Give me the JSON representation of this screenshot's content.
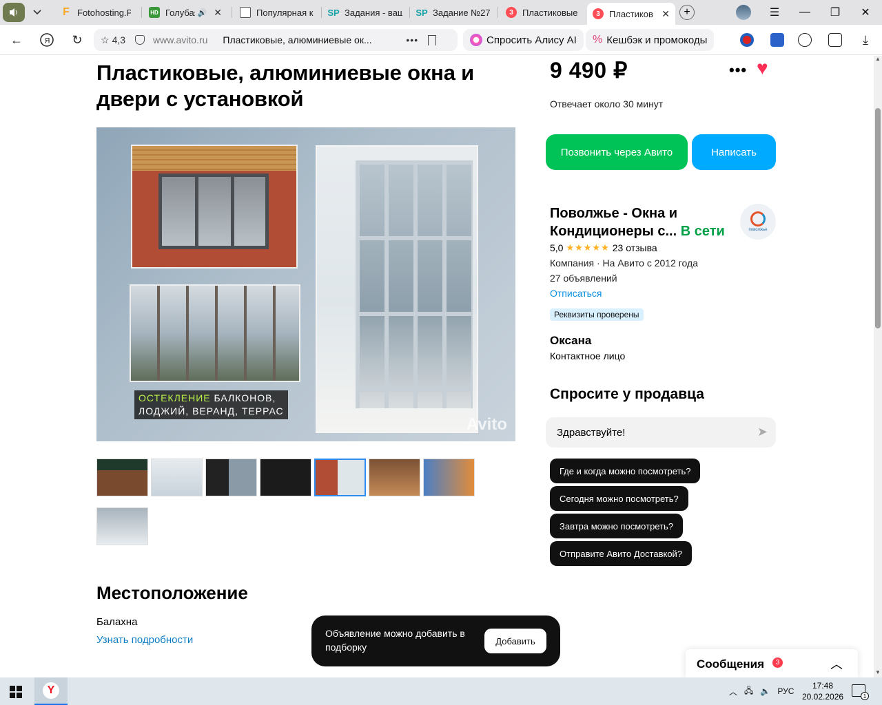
{
  "browser": {
    "tabs": [
      {
        "label": "Fotohosting.P",
        "favicon": "F",
        "favicon_color": "#f5a623"
      },
      {
        "label": "Голубая",
        "favicon": "HD",
        "favicon_color": "#3a9a3a"
      },
      {
        "label": "Популярная к",
        "favicon": "",
        "favicon_color": "#888888"
      },
      {
        "label": "Задания - ваш",
        "favicon": "SP",
        "favicon_color": "#1aa3a8"
      },
      {
        "label": "Задание №27",
        "favicon": "SP",
        "favicon_color": "#1aa3a8"
      },
      {
        "label": "Пластиковые",
        "favicon": "3",
        "favicon_color": "#ff4d55"
      },
      {
        "label": "Пластиков",
        "favicon": "3",
        "favicon_color": "#ff4d55"
      }
    ],
    "rating": "4,3",
    "domain": "www.avito.ru",
    "page_title": "Пластиковые, алюминиевые ок...",
    "alice_label": "Спросить Алису AI",
    "cashback_label": "Кешбэк и промокоды"
  },
  "listing": {
    "title": "Пластиковые, алюминиевые окна и двери с установкой",
    "price": "9 490 ₽",
    "answers": "Отвечает около 30 минут",
    "call_button": "Позвонить через Авито",
    "write_button": "Написать",
    "image_caption_1": "ОСТЕКЛЕНИЕ",
    "image_caption_2": " БАЛКОНОВ,",
    "image_caption_3": "ЛОДЖИЙ, ВЕРАНД, ТЕРРАС",
    "watermark": "Avito",
    "thumbnail_count": 8,
    "selected_thumbnail": 5
  },
  "seller": {
    "name": "Поволжье - Окна и Кондиционеры с...",
    "status": "В сети",
    "avatar_label": "поволжье",
    "rating": "5,0",
    "stars": "★★★★★",
    "reviews": "23 отзыва",
    "company_info": "Компания · На Авито с 2012 года",
    "ads_count": "27 объявлений",
    "unsubscribe": "Отписаться",
    "verified_badge": "Реквизиты проверены",
    "contact_name": "Оксана",
    "contact_role": "Контактное лицо"
  },
  "ask": {
    "heading": "Спросите у продавца",
    "input_value": "Здравствуйте!",
    "quick_questions": [
      "Где и когда можно посмотреть?",
      "Сегодня можно посмотреть?",
      "Завтра можно посмотреть?",
      "Отправите Авито Доставкой?"
    ]
  },
  "location": {
    "heading": "Местоположение",
    "city": "Балахна",
    "details_link": "Узнать подробности"
  },
  "toast": {
    "text": "Объявление можно добавить в подборку",
    "button": "Добавить"
  },
  "messages": {
    "label": "Сообщения",
    "count": "3"
  },
  "taskbar": {
    "language": "РУС",
    "time": "17:48",
    "date": "20.02.2026",
    "notif_count": "1"
  }
}
